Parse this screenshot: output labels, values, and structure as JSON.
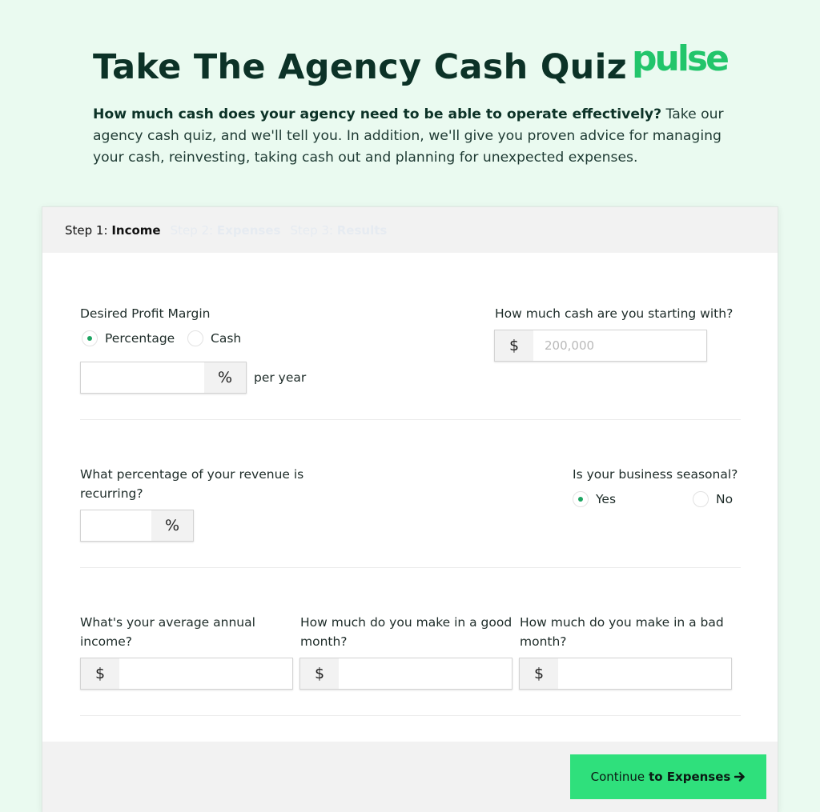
{
  "page": {
    "title": "Take The Agency Cash Quiz",
    "logo_text": "pulse",
    "intro_bold": "How much cash does your agency need to be able to operate effectively?",
    "intro_rest": " Take our agency cash quiz, and we'll tell you. In addition, we'll give you proven advice for managing your cash, reinvesting, taking cash out and planning for unexpected expenses."
  },
  "steps": [
    {
      "prefix": "Step 1:",
      "name": "Income",
      "active": true
    },
    {
      "prefix": "Step 2:",
      "name": "Expenses",
      "active": false
    },
    {
      "prefix": "Step 3:",
      "name": "Results",
      "active": false
    }
  ],
  "form": {
    "profit_margin": {
      "label": "Desired Profit Margin",
      "option_percentage": "Percentage",
      "option_cash": "Cash",
      "selected": "Percentage",
      "value": "",
      "unit": "%",
      "suffix": "per year"
    },
    "starting_cash": {
      "label": "How much cash are you starting with?",
      "prefix": "$",
      "placeholder": "200,000",
      "value": ""
    },
    "recurring": {
      "label": "What percentage of your revenue is recurring?",
      "value": "",
      "unit": "%"
    },
    "seasonal": {
      "label": "Is your business seasonal?",
      "option_yes": "Yes",
      "option_no": "No",
      "selected": "Yes"
    },
    "annual_income": {
      "label": "What's your average annual income?",
      "prefix": "$",
      "value": ""
    },
    "good_month": {
      "label": "How much do you make in a good month?",
      "prefix": "$",
      "value": ""
    },
    "bad_month": {
      "label": "How much do you make in a bad month?",
      "prefix": "$",
      "value": ""
    }
  },
  "footer": {
    "continue_prefix": "Continue",
    "continue_bold": "to Expenses",
    "arrow_icon": "arrow-right-icon"
  },
  "colors": {
    "background": "#eafaf0",
    "accent_green": "#2fe07c",
    "logo_green": "#22c56b",
    "title_dark": "#0c3227"
  }
}
